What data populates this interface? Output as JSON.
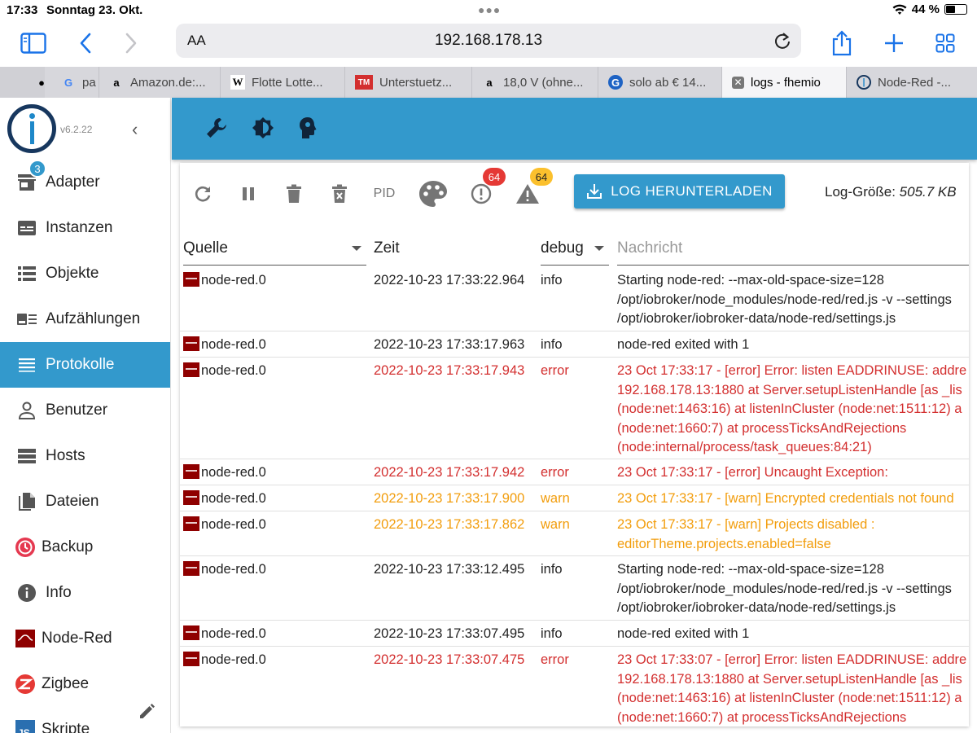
{
  "statusbar": {
    "time": "17:33",
    "date": "Sonntag 23. Okt.",
    "battery": "44 %",
    "battery_level": 0.44
  },
  "browser": {
    "url_prefix": "AA",
    "url": "192.168.178.13",
    "tabs": [
      {
        "label": "pa",
        "favicon": "google-icon"
      },
      {
        "label": "Amazon.de:...",
        "favicon": "amazon-icon"
      },
      {
        "label": "Flotte Lotte...",
        "favicon": "wikipedia-icon"
      },
      {
        "label": "Unterstuetz...",
        "favicon": "site-icon"
      },
      {
        "label": "18,0 V (ohne...",
        "favicon": "amazon-icon"
      },
      {
        "label": "solo ab € 14...",
        "favicon": "g-icon"
      },
      {
        "label": "logs - fhemio",
        "favicon": "close-icon",
        "active": true
      },
      {
        "label": "Node-Red -...",
        "favicon": "iobroker-icon"
      }
    ]
  },
  "sidebar": {
    "version": "v6.2.22",
    "adapter_badge": "3",
    "items": [
      {
        "label": "Adapter",
        "icon": "store-icon"
      },
      {
        "label": "Instanzen",
        "icon": "instances-icon"
      },
      {
        "label": "Objekte",
        "icon": "list-icon"
      },
      {
        "label": "Aufzählungen",
        "icon": "enum-icon"
      },
      {
        "label": "Protokolle",
        "icon": "menu-icon",
        "active": true
      },
      {
        "label": "Benutzer",
        "icon": "user-icon"
      },
      {
        "label": "Hosts",
        "icon": "hosts-icon"
      },
      {
        "label": "Dateien",
        "icon": "files-icon"
      },
      {
        "label": "Backup",
        "icon": "backup-icon"
      },
      {
        "label": "Info",
        "icon": "info-icon"
      },
      {
        "label": "Node-Red",
        "icon": "node-red-icon"
      },
      {
        "label": "Zigbee",
        "icon": "zigbee-icon"
      },
      {
        "label": "Skripte",
        "icon": "scripts-icon"
      }
    ]
  },
  "log_toolbar": {
    "pid_label": "PID",
    "error_count": "64",
    "warn_count": "64",
    "download_label": "LOG HERUNTERLADEN",
    "size_label": "Log-Größe:",
    "size_value": "505.7 KB"
  },
  "table": {
    "headers": {
      "source": "Quelle",
      "time": "Zeit",
      "level": "debug",
      "message": "Nachricht"
    },
    "rows": [
      {
        "source": "node-red.0",
        "time": "2022-10-23 17:33:22.964",
        "level": "info",
        "message": "Starting node-red: --max-old-space-size=128\n/opt/iobroker/node_modules/node-red/red.js -v --settings\n/opt/iobroker/iobroker-data/node-red/settings.js"
      },
      {
        "source": "node-red.0",
        "time": "2022-10-23 17:33:17.963",
        "level": "info",
        "message": "node-red exited with 1"
      },
      {
        "source": "node-red.0",
        "time": "2022-10-23 17:33:17.943",
        "level": "error",
        "message": "23 Oct 17:33:17 - [error] Error: listen EADDRINUSE: addre\n192.168.178.13:1880 at Server.setupListenHandle [as _lis\n(node:net:1463:16) at listenInCluster (node:net:1511:12) a\n(node:net:1660:7) at processTicksAndRejections\n(node:internal/process/task_queues:84:21)"
      },
      {
        "source": "node-red.0",
        "time": "2022-10-23 17:33:17.942",
        "level": "error",
        "message": "23 Oct 17:33:17 - [error] Uncaught Exception:"
      },
      {
        "source": "node-red.0",
        "time": "2022-10-23 17:33:17.900",
        "level": "warn",
        "message": "23 Oct 17:33:17 - [warn] Encrypted credentials not found"
      },
      {
        "source": "node-red.0",
        "time": "2022-10-23 17:33:17.862",
        "level": "warn",
        "message": "23 Oct 17:33:17 - [warn] Projects disabled :\neditorTheme.projects.enabled=false"
      },
      {
        "source": "node-red.0",
        "time": "2022-10-23 17:33:12.495",
        "level": "info",
        "message": "Starting node-red: --max-old-space-size=128\n/opt/iobroker/node_modules/node-red/red.js -v --settings\n/opt/iobroker/iobroker-data/node-red/settings.js"
      },
      {
        "source": "node-red.0",
        "time": "2022-10-23 17:33:07.495",
        "level": "info",
        "message": "node-red exited with 1"
      },
      {
        "source": "node-red.0",
        "time": "2022-10-23 17:33:07.475",
        "level": "error",
        "message": "23 Oct 17:33:07 - [error] Error: listen EADDRINUSE: addre\n192.168.178.13:1880 at Server.setupListenHandle [as _lis\n(node:net:1463:16) at listenInCluster (node:net:1511:12) a\n(node:net:1660:7) at processTicksAndRejections"
      }
    ]
  }
}
